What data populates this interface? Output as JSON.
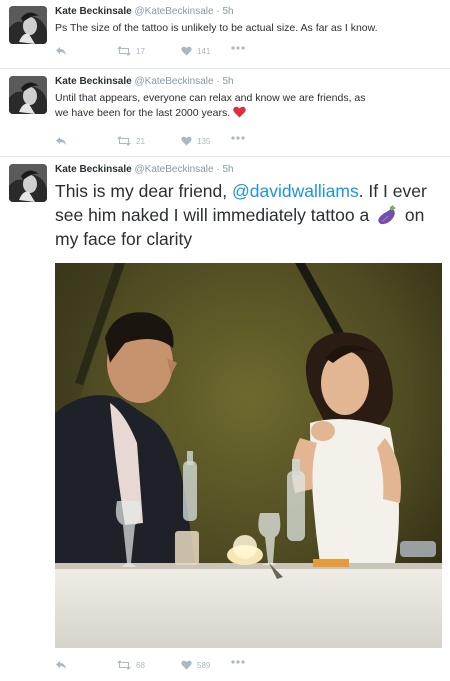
{
  "tweets": [
    {
      "name": "Kate Beckinsale",
      "handle": "@KateBeckinsale",
      "dot": "·",
      "time": "5h",
      "text": "Ps  The size of the tattoo is unlikely to be actual size. As far as I know.",
      "retweets": "17",
      "likes": "141"
    },
    {
      "name": "Kate Beckinsale",
      "handle": "@KateBeckinsale",
      "dot": "·",
      "time": "5h",
      "text_line1": "Until that appears, everyone can relax and know we are friends, as",
      "text_line2": "we have been for the last 2000 years.",
      "emoji": "red-heart",
      "retweets": "21",
      "likes": "135"
    },
    {
      "name": "Kate Beckinsale",
      "handle": "@KateBeckinsale",
      "dot": "·",
      "time": "5h",
      "text_part1": "This is my dear friend, ",
      "mention": "@davidwalliams",
      "text_part2": ". If I ever see him naked I will immediately tattoo a",
      "emoji": "eggplant",
      "text_part3": " on my face for clarity",
      "retweets": "68",
      "likes": "589",
      "photo": "photo of two people at a dinner table"
    }
  ],
  "icons": [
    "reply-icon",
    "retweet-icon",
    "like-icon",
    "more-icon"
  ],
  "colors": {
    "mention": "#1b95e0",
    "muted": "#8899a6",
    "icon": "#aab8c2",
    "heart": "#e0245e"
  }
}
